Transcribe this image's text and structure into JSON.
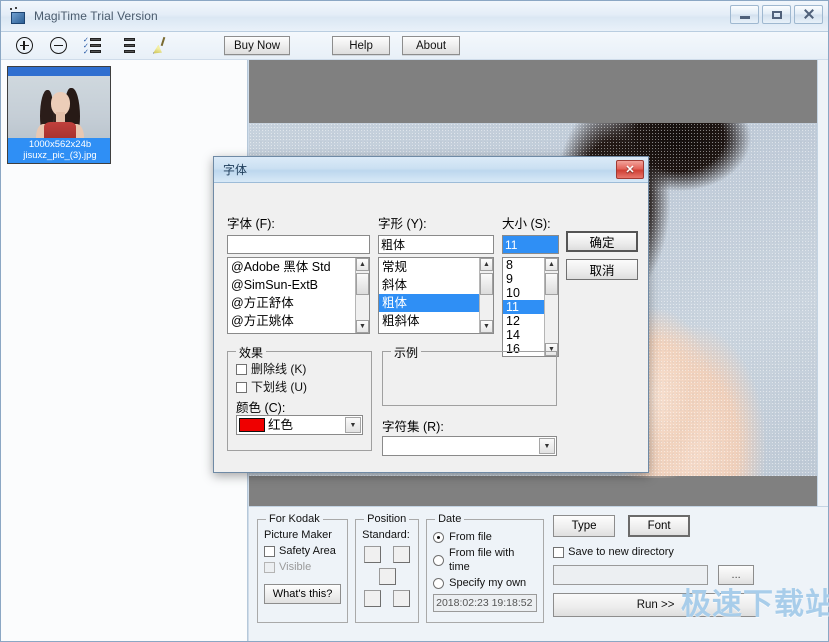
{
  "window": {
    "title": "MagiTime Trial Version",
    "icon": "app-icon",
    "caption": {
      "minimize": "minimize-icon",
      "maximize": "maximize-icon",
      "close": "close-icon"
    }
  },
  "toolbar": {
    "icons": [
      {
        "name": "add-icon",
        "glyph": "plus-circle"
      },
      {
        "name": "remove-icon",
        "glyph": "minus-circle"
      },
      {
        "name": "select-all-icon",
        "glyph": "checked-list"
      },
      {
        "name": "list-icon",
        "glyph": "list"
      },
      {
        "name": "clear-icon",
        "glyph": "broom"
      }
    ],
    "buy_now": "Buy Now",
    "help": "Help",
    "about": "About"
  },
  "file_pane": {
    "thumbnail": {
      "dimensions": "1000x562x24b",
      "filename": "jisuxz_pic_(3).jpg"
    }
  },
  "options": {
    "kodak": {
      "legend": "For Kodak",
      "subtitle": "Picture Maker",
      "safety_area": "Safety Area",
      "visible": "Visible",
      "whats_this": "What's this?"
    },
    "position": {
      "legend": "Position",
      "standard_label": "Standard:"
    },
    "date": {
      "legend": "Date",
      "from_file": "From file",
      "from_file_with_time": "From file with time",
      "specify_my_own": "Specify my own",
      "value": "2018:02:23 19:18:52"
    },
    "right": {
      "type_button": "Type",
      "font_button": "Font",
      "save_to_new_directory": "Save to new directory",
      "path_value": "",
      "browse_button": "...",
      "run_button": "Run >>"
    },
    "watermark": "极速下载站"
  },
  "font_dialog": {
    "title": "字体",
    "close_icon": "close-icon",
    "font_label": "字体 (F):",
    "font_value": "",
    "font_list": [
      "@Adobe 黑体 Std",
      "@SimSun-ExtB",
      "@方正舒体",
      "@方正姚体"
    ],
    "style_label": "字形 (Y):",
    "style_value": "粗体",
    "style_list": [
      "常规",
      "斜体",
      "粗体",
      "粗斜体"
    ],
    "style_selected": "粗体",
    "size_label": "大小 (S):",
    "size_value": "11",
    "size_list": [
      "8",
      "9",
      "10",
      "11",
      "12",
      "14",
      "16"
    ],
    "size_selected": "11",
    "ok_button": "确定",
    "cancel_button": "取消",
    "effects_legend": "效果",
    "strikeout": "删除线 (K)",
    "underline": "下划线 (U)",
    "color_label": "颜色 (C):",
    "color_value": "红色",
    "color_hex": "#ef0000",
    "sample_legend": "示例",
    "sample_text": "",
    "charset_label": "字符集 (R):",
    "charset_value": ""
  },
  "colors": {
    "selection": "#2f8ff5",
    "dialog_bg": "#f0f0f0",
    "viewer_bg": "#808080"
  }
}
